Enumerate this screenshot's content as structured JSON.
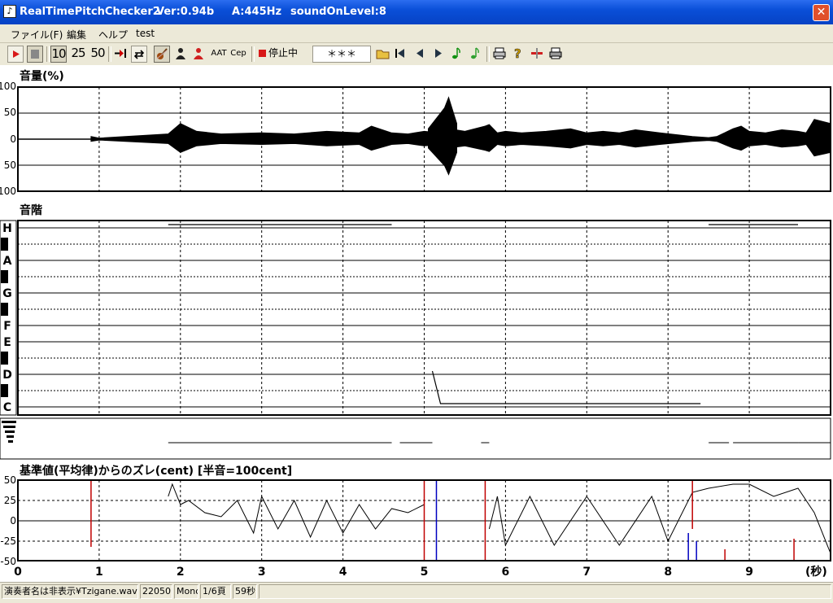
{
  "window": {
    "title_app": "RealTimePitchChecker2",
    "title_version": "Ver:0.94b",
    "title_a": "A:445Hz",
    "title_level": "soundOnLevel:8",
    "close_glyph": "✕"
  },
  "menu": [
    "ファイル(F)",
    "編集",
    "ヘルプ",
    "test"
  ],
  "toolbar": {
    "play_icon": "play-icon",
    "stop_icon": "stop-icon",
    "speed_options": [
      "10",
      "25",
      "50"
    ],
    "stop_label": "停止中",
    "note_display": "＊＊＊",
    "extra_labels": [
      "AAT",
      "Cep"
    ]
  },
  "panels": {
    "volume": {
      "title": "音量(%)",
      "y_labels": [
        "100",
        "50",
        "0",
        "50",
        "100"
      ]
    },
    "scale": {
      "title": "音階",
      "note_labels": [
        "H",
        "A",
        "G",
        "F",
        "E",
        "D",
        "C"
      ]
    },
    "deviation": {
      "title": "基準値(平均律)からのズレ(cent) [半音=100cent]",
      "y_labels": [
        "50",
        "25",
        "0",
        "-25",
        "-50"
      ]
    }
  },
  "x_axis": {
    "ticks": [
      "0",
      "1",
      "2",
      "3",
      "4",
      "5",
      "6",
      "7",
      "8",
      "9"
    ],
    "unit": "(秒)"
  },
  "statusbar": [
    "演奏者名は非表示¥Tzigane.wav",
    "22050",
    "Mono",
    "1/6頁",
    "59秒"
  ],
  "chart_data": [
    {
      "type": "area",
      "title": "音量(%)",
      "xlabel": "(秒)",
      "xlim": [
        0,
        10
      ],
      "ylim": [
        -100,
        100
      ],
      "grid": true,
      "series": [
        {
          "x": [
            0.9,
            1.0,
            1.85,
            2.0,
            2.2,
            2.5,
            3.0,
            3.4,
            3.8,
            4.2,
            4.35,
            4.6,
            4.8,
            5.0,
            5.2,
            5.3,
            5.5,
            5.75,
            5.8,
            5.9,
            6.0,
            6.2,
            6.5,
            6.8,
            7.0,
            7.2,
            7.4,
            7.6,
            7.9,
            8.3,
            8.5,
            8.6,
            8.8,
            8.9,
            9.0,
            9.2,
            9.4,
            9.6,
            9.7,
            9.8,
            10.0
          ],
          "y": [
            5,
            2,
            10,
            30,
            15,
            10,
            12,
            10,
            15,
            12,
            25,
            12,
            10,
            15,
            12,
            20,
            15,
            25,
            28,
            12,
            15,
            12,
            15,
            20,
            12,
            15,
            12,
            18,
            12,
            5,
            3,
            5,
            20,
            25,
            15,
            12,
            18,
            15,
            12,
            38,
            30
          ]
        },
        {
          "x": [
            5.05,
            5.1,
            5.2,
            5.25,
            5.3,
            5.4
          ],
          "y": [
            20,
            30,
            50,
            60,
            80,
            30
          ]
        }
      ]
    },
    {
      "type": "line",
      "title": "音階",
      "xlabel": "(秒)",
      "xlim": [
        0,
        10
      ],
      "y_categories": [
        "H",
        "A",
        "G",
        "F",
        "E",
        "D",
        "C"
      ],
      "grid": true,
      "series": [
        {
          "x": [
            1.85,
            2.0,
            2.5,
            3.0,
            3.5,
            4.0,
            4.6
          ],
          "y": [
            "H",
            "H",
            "H",
            "H",
            "H",
            "H",
            "H"
          ]
        },
        {
          "x": [
            5.1,
            5.2,
            5.4,
            5.7,
            5.8,
            6.0,
            6.5,
            7.0,
            7.5,
            8.0,
            8.4
          ],
          "y": [
            "D",
            "C",
            "C",
            "C",
            "C",
            "C",
            "C",
            "C",
            "C",
            "C",
            "C"
          ]
        },
        {
          "x": [
            8.5,
            8.7,
            9.0,
            9.5,
            9.6
          ],
          "y": [
            "H",
            "H",
            "H",
            "H",
            "H"
          ]
        }
      ]
    },
    {
      "type": "line",
      "title": "基準値(平均律)からのズレ(cent) [半音=100cent]",
      "xlabel": "(秒)",
      "xlim": [
        0,
        10
      ],
      "ylim": [
        -50,
        50
      ],
      "grid": true,
      "series": [
        {
          "x": [
            1.85,
            1.9,
            2.0,
            2.1,
            2.3,
            2.5,
            2.7,
            2.9,
            3.0,
            3.2,
            3.4,
            3.6,
            3.8,
            4.0,
            4.2,
            4.4,
            4.6,
            4.8,
            5.0
          ],
          "y": [
            30,
            45,
            20,
            25,
            10,
            5,
            25,
            -15,
            30,
            -10,
            25,
            -20,
            25,
            -15,
            20,
            -10,
            15,
            10,
            20
          ]
        },
        {
          "x": [
            5.8,
            5.9,
            6.0,
            6.3,
            6.6,
            7.0,
            7.4,
            7.8,
            8.0,
            8.3,
            8.5,
            8.8,
            9.0,
            9.3,
            9.6,
            9.8,
            10.0
          ],
          "y": [
            -10,
            30,
            -30,
            30,
            -30,
            30,
            -30,
            30,
            -25,
            35,
            40,
            45,
            45,
            30,
            40,
            10,
            -40
          ]
        }
      ]
    }
  ]
}
